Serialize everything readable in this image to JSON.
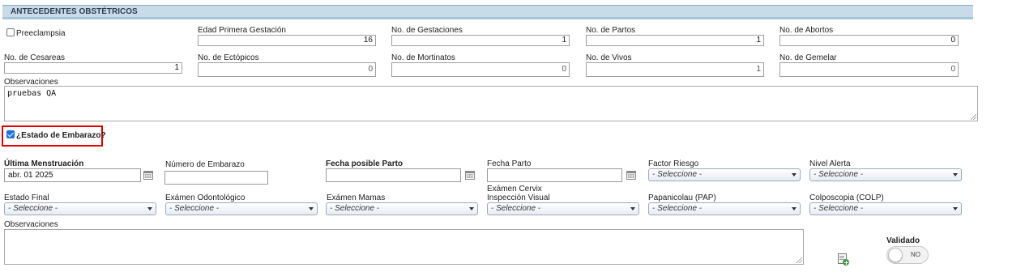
{
  "header": {
    "title": "ANTECEDENTES OBSTÉTRICOS"
  },
  "obstetric": {
    "preeclampsia_label": "Preeclampsia",
    "preeclampsia_checked": false,
    "edad_primera_label": "Edad Primera Gestación",
    "edad_primera_value": "16",
    "gestaciones_label": "No. de Gestaciones",
    "gestaciones_value": "1",
    "partos_label": "No. de Partos",
    "partos_value": "1",
    "abortos_label": "No. de Abortos",
    "abortos_value": "0",
    "cesareas_label": "No. de Cesareas",
    "cesareas_value": "1",
    "ectopicos_label": "No. de Ectópicos",
    "ectopicos_value": "0",
    "mortinatos_label": "No. de Mortinatos",
    "mortinatos_value": "0",
    "vivos_label": "No. de Vivos",
    "vivos_value": "1",
    "gemelar_label": "No. de Gemelar",
    "gemelar_value": "0",
    "observaciones_label": "Observaciones",
    "observaciones_value": "pruebas QA"
  },
  "embarazo": {
    "estado_label": "¿Estado de Embarazo?",
    "estado_checked": true,
    "ultima_menstruacion_label": "Última Menstruación",
    "ultima_menstruacion_value": "abr. 01 2025",
    "numero_embarazo_label": "Número de Embarazo",
    "numero_embarazo_value": "",
    "fecha_posible_parto_label": "Fecha posible Parto",
    "fecha_posible_parto_value": "",
    "fecha_parto_label": "Fecha Parto",
    "fecha_parto_value": "",
    "factor_riesgo_label": "Factor Riesgo",
    "nivel_alerta_label": "Nivel Alerta",
    "estado_final_label": "Estado Final",
    "odontologico_label": "Exámen Odontológico",
    "mamas_label": "Exámen Mamas",
    "cervix_label_line1": "Exámen Cervix",
    "cervix_label_line2": "Inspección Visual",
    "pap_label": "Papanicolau (PAP)",
    "colp_label": "Colposcopia (COLP)",
    "select_placeholder": "- Seleccione -",
    "observaciones_label": "Observaciones",
    "observaciones_value": "",
    "validado_label": "Validado",
    "validado_toggle_text": "NO",
    "validado_on": false
  },
  "icons": {
    "calendar": "calendar-icon",
    "add_document": "add-document-icon",
    "dropdown": "chevron-down-icon"
  },
  "colors": {
    "header_bg": "#c8dbe8",
    "highlight_border": "#e60000",
    "checkbox_checked": "#1a73e8"
  }
}
